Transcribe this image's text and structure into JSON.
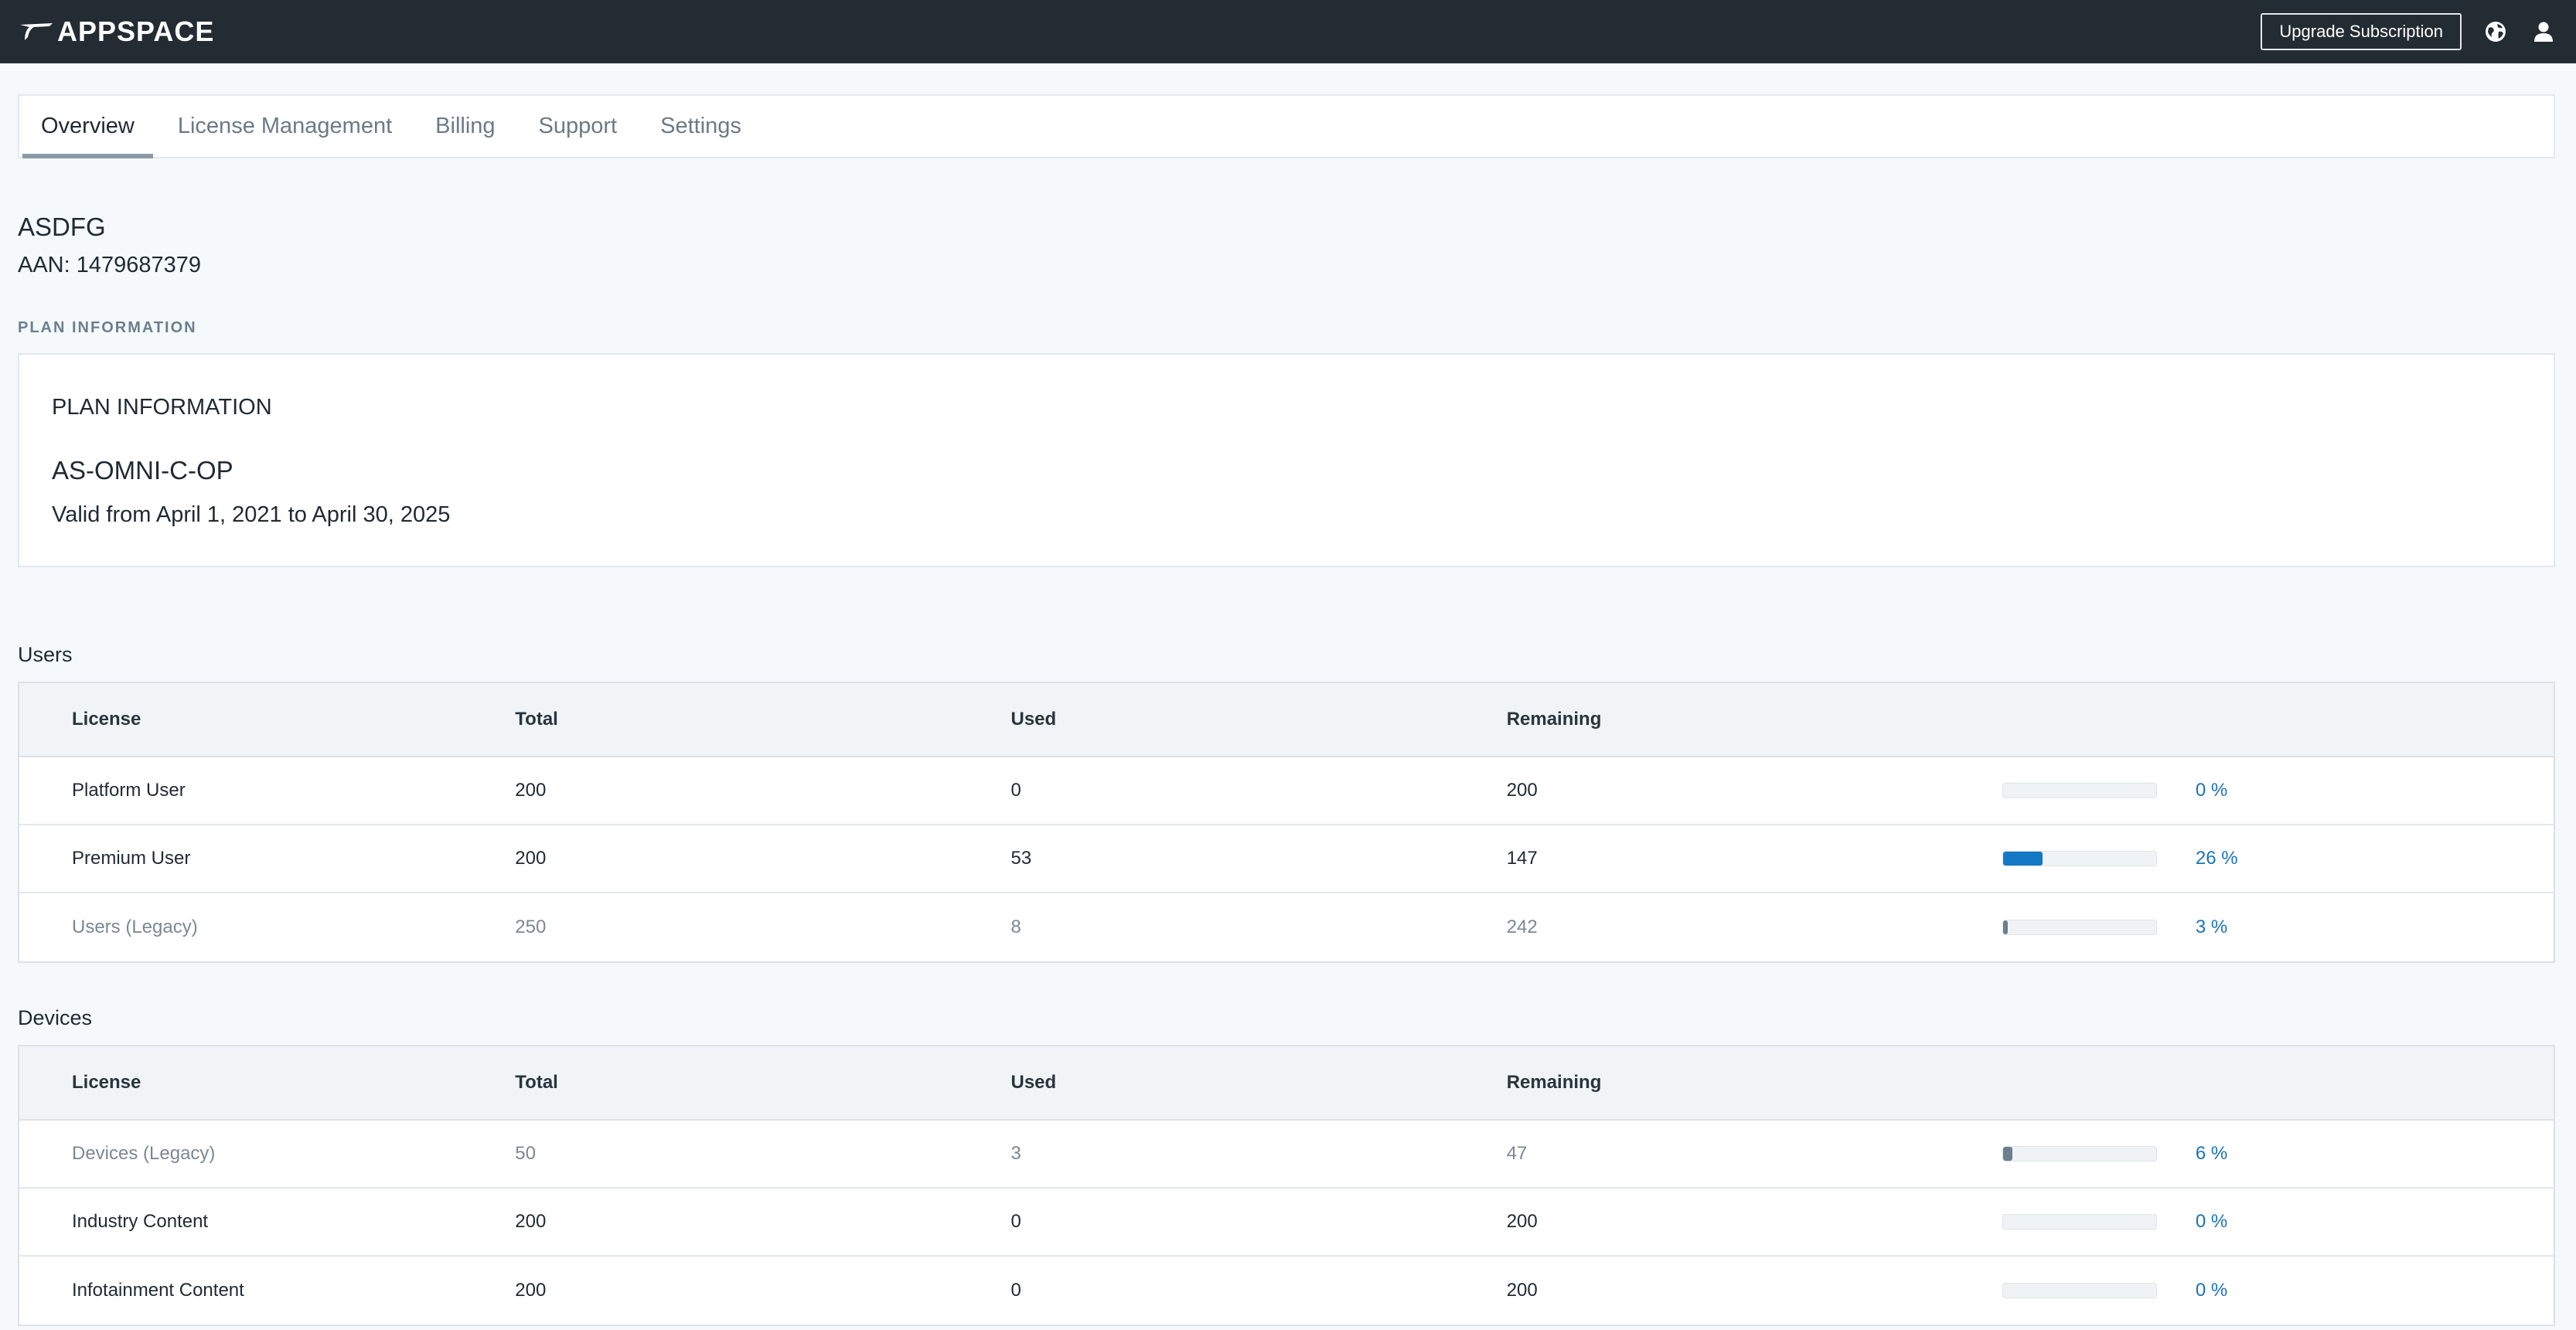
{
  "header": {
    "brand": "APPSPACE",
    "upgrade_label": "Upgrade Subscription",
    "icons": [
      "globe-icon",
      "user-icon"
    ],
    "bg_color": "#232b33"
  },
  "tabs": [
    {
      "label": "Overview",
      "active": true
    },
    {
      "label": "License Management",
      "active": false
    },
    {
      "label": "Billing",
      "active": false
    },
    {
      "label": "Support",
      "active": false
    },
    {
      "label": "Settings",
      "active": false
    }
  ],
  "account": {
    "name": "ASDFG",
    "aan": "AAN: 1479687379"
  },
  "plan": {
    "section_caption": "PLAN INFORMATION",
    "title": "PLAN INFORMATION",
    "code": "AS-OMNI-C-OP",
    "valid": "Valid from April 1, 2021 to April 30, 2025"
  },
  "columns": {
    "license": "License",
    "total": "Total",
    "used": "Used",
    "remaining": "Remaining"
  },
  "users": {
    "label": "Users",
    "rows": [
      {
        "license": "Platform User",
        "total": "200",
        "used": "0",
        "remaining": "200",
        "percent": 0,
        "percent_label": "0 %",
        "legacy": false
      },
      {
        "license": "Premium User",
        "total": "200",
        "used": "53",
        "remaining": "147",
        "percent": 26,
        "percent_label": "26 %",
        "legacy": false
      },
      {
        "license": "Users (Legacy)",
        "total": "250",
        "used": "8",
        "remaining": "242",
        "percent": 3,
        "percent_label": "3 %",
        "legacy": true
      }
    ]
  },
  "devices": {
    "label": "Devices",
    "rows": [
      {
        "license": "Devices (Legacy)",
        "total": "50",
        "used": "3",
        "remaining": "47",
        "percent": 6,
        "percent_label": "6 %",
        "legacy": true
      },
      {
        "license": "Industry Content",
        "total": "200",
        "used": "0",
        "remaining": "200",
        "percent": 0,
        "percent_label": "0 %",
        "legacy": false
      },
      {
        "license": "Infotainment Content",
        "total": "200",
        "used": "0",
        "remaining": "200",
        "percent": 0,
        "percent_label": "0 %",
        "legacy": false
      }
    ]
  },
  "colors": {
    "accent": "#1479c4",
    "legacy_bar": "#6b7f8e",
    "percent_text": "#1a73b8"
  }
}
